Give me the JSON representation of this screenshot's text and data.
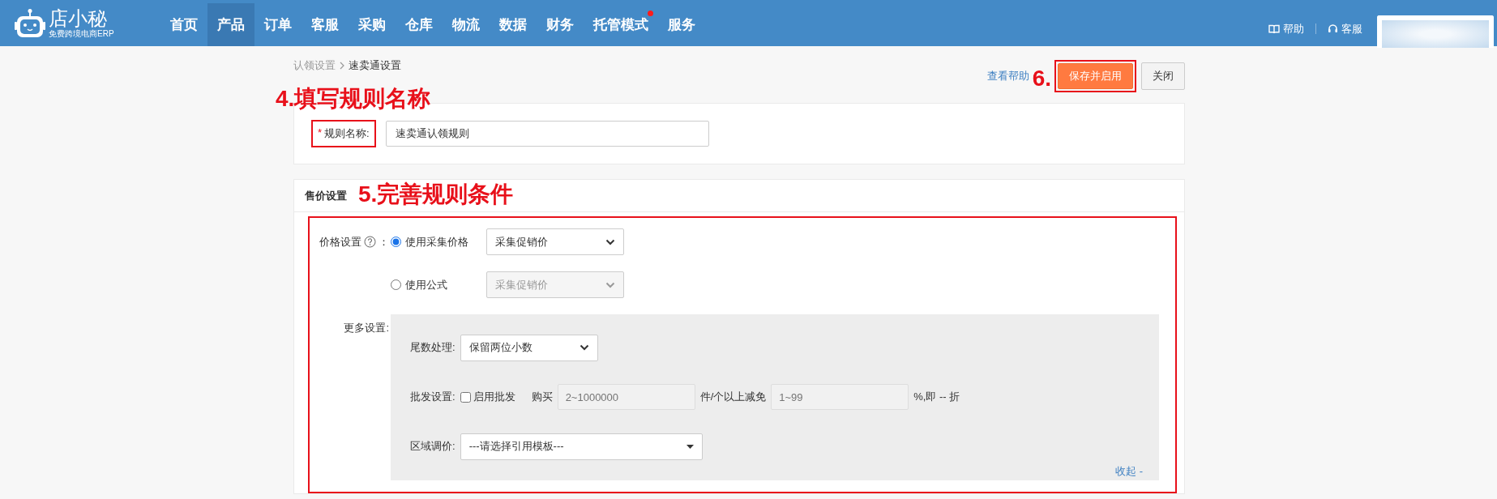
{
  "header": {
    "logo": {
      "name": "店小秘",
      "tagline": "免费跨境电商ERP"
    },
    "nav": [
      {
        "label": "首页",
        "selected": false,
        "badge": false
      },
      {
        "label": "产品",
        "selected": true,
        "badge": false
      },
      {
        "label": "订单",
        "selected": false,
        "badge": false
      },
      {
        "label": "客服",
        "selected": false,
        "badge": false
      },
      {
        "label": "采购",
        "selected": false,
        "badge": false
      },
      {
        "label": "仓库",
        "selected": false,
        "badge": false
      },
      {
        "label": "物流",
        "selected": false,
        "badge": false
      },
      {
        "label": "数据",
        "selected": false,
        "badge": false
      },
      {
        "label": "财务",
        "selected": false,
        "badge": false
      },
      {
        "label": "托管模式",
        "selected": false,
        "badge": true
      },
      {
        "label": "服务",
        "selected": false,
        "badge": false
      }
    ],
    "links": [
      {
        "kind": "help",
        "label": "帮助"
      },
      {
        "kind": "service",
        "label": "客服"
      }
    ]
  },
  "breadcrumb": [
    "认领设置",
    "速卖通设置"
  ],
  "actions": {
    "help_link": "查看帮助",
    "annotation": "6.",
    "save": "保存并启用",
    "close": "关闭"
  },
  "name_section": {
    "annotation": "4.填写规则名称",
    "required_mark": "*",
    "label": "规则名称:",
    "value": "速卖通认领规则"
  },
  "price_section": {
    "title": "售价设置",
    "annotation": "5.完善规则条件",
    "price_label": "价格设置",
    "price_colon": "：",
    "price_options": [
      {
        "label": "使用采集价格",
        "selected": true,
        "select": "采集促销价"
      },
      {
        "label": "使用公式",
        "selected": false,
        "select": "采集促销价"
      }
    ],
    "more_label": "更多设置:",
    "rounding": {
      "label": "尾数处理:",
      "value": "保留两位小数"
    },
    "wholesale": {
      "label": "批发设置:",
      "checked": false,
      "checkbox_label": "启用批发",
      "buy": "购买",
      "qty_placeholder": "2~1000000",
      "mid": "件/个以上减免",
      "pct_placeholder": "1~99",
      "suffix": "%,即 -- 折"
    },
    "region": {
      "label": "区域调价:",
      "value": "---请选择引用模板---"
    },
    "collapse": "收起 -"
  }
}
